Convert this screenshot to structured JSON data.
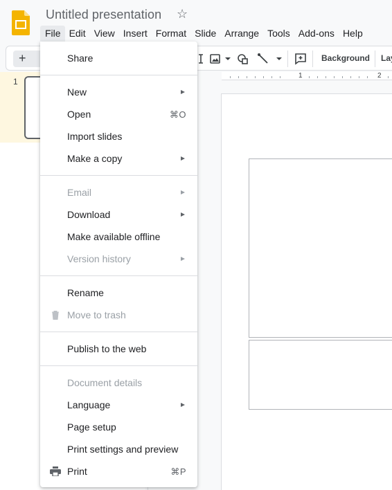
{
  "app": {
    "title": "Untitled presentation",
    "star_icon": "star-outline-icon",
    "logo_icon": "google-slides-logo"
  },
  "menubar": [
    "File",
    "Edit",
    "View",
    "Insert",
    "Format",
    "Slide",
    "Arrange",
    "Tools",
    "Add-ons",
    "Help"
  ],
  "toolbar": {
    "new_slide": "+",
    "background_label": "Background",
    "layout_label": "Lay"
  },
  "ruler": {
    "marks": [
      "1",
      "2"
    ]
  },
  "filmstrip": {
    "slide_number": "1"
  },
  "file_menu": {
    "share": "Share",
    "new": "New",
    "open": "Open",
    "open_shortcut": "⌘O",
    "import_slides": "Import slides",
    "make_copy": "Make a copy",
    "email": "Email",
    "download": "Download",
    "make_offline": "Make available offline",
    "version_history": "Version history",
    "rename": "Rename",
    "move_to_trash": "Move to trash",
    "publish": "Publish to the web",
    "document_details": "Document details",
    "language": "Language",
    "page_setup": "Page setup",
    "print_settings": "Print settings and preview",
    "print": "Print",
    "print_shortcut": "⌘P"
  },
  "colors": {
    "brand": "#f4b400",
    "active_slide_bg": "#fef7e0",
    "disabled_text": "#9aa0a6"
  }
}
